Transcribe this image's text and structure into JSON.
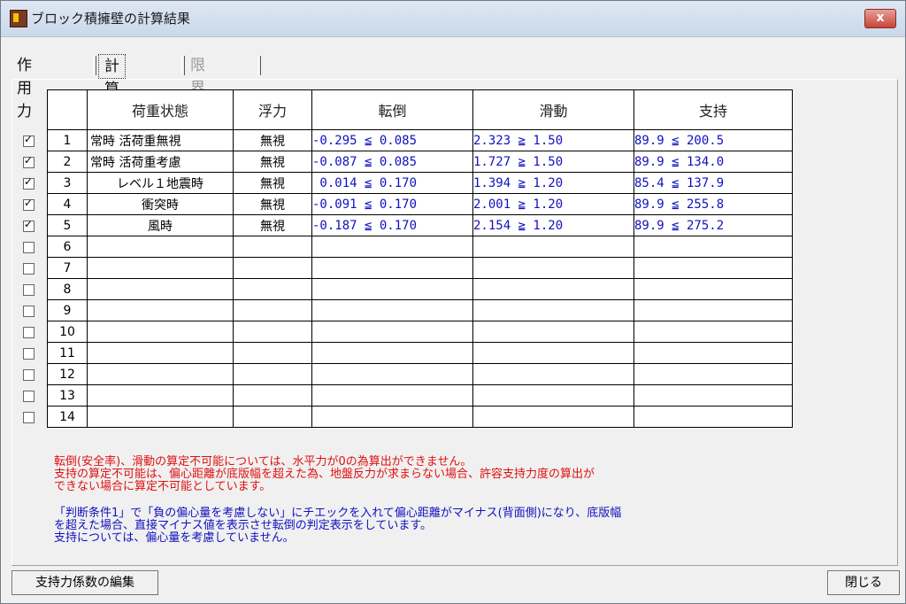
{
  "window": {
    "title": "ブロック積擁壁の計算結果",
    "close_label": "x"
  },
  "tabs": [
    {
      "label": "作用力"
    },
    {
      "label": "計算結果"
    },
    {
      "label": "限界高"
    }
  ],
  "table": {
    "headers": {
      "no": "",
      "load": "荷重状態",
      "buoyancy": "浮力",
      "overturn": "転倒",
      "sliding": "滑動",
      "support": "支持"
    },
    "rows": [
      {
        "checked": true,
        "no": "1",
        "load": "常時 活荷重無視",
        "buoyancy": "無視",
        "overturn": "-0.295 ≦ 0.085",
        "sliding": "2.323 ≧ 1.50",
        "support": "89.9 ≦ 200.5"
      },
      {
        "checked": true,
        "no": "2",
        "load": "常時 活荷重考慮",
        "buoyancy": "無視",
        "overturn": "-0.087 ≦ 0.085",
        "sliding": "1.727 ≧ 1.50",
        "support": "89.9 ≦ 134.0"
      },
      {
        "checked": true,
        "no": "3",
        "load": "レベル１地震時",
        "buoyancy": "無視",
        "overturn": " 0.014 ≦ 0.170",
        "sliding": "1.394 ≧ 1.20",
        "support": "85.4 ≦ 137.9"
      },
      {
        "checked": true,
        "no": "4",
        "load": "衝突時",
        "buoyancy": "無視",
        "overturn": "-0.091 ≦ 0.170",
        "sliding": "2.001 ≧ 1.20",
        "support": "89.9 ≦ 255.8"
      },
      {
        "checked": true,
        "no": "5",
        "load": "風時",
        "buoyancy": "無視",
        "overturn": "-0.187 ≦ 0.170",
        "sliding": "2.154 ≧ 1.20",
        "support": "89.9 ≦ 275.2"
      },
      {
        "checked": false,
        "no": "6",
        "load": "",
        "buoyancy": "",
        "overturn": "",
        "sliding": "",
        "support": ""
      },
      {
        "checked": false,
        "no": "7",
        "load": "",
        "buoyancy": "",
        "overturn": "",
        "sliding": "",
        "support": ""
      },
      {
        "checked": false,
        "no": "8",
        "load": "",
        "buoyancy": "",
        "overturn": "",
        "sliding": "",
        "support": ""
      },
      {
        "checked": false,
        "no": "9",
        "load": "",
        "buoyancy": "",
        "overturn": "",
        "sliding": "",
        "support": ""
      },
      {
        "checked": false,
        "no": "10",
        "load": "",
        "buoyancy": "",
        "overturn": "",
        "sliding": "",
        "support": ""
      },
      {
        "checked": false,
        "no": "11",
        "load": "",
        "buoyancy": "",
        "overturn": "",
        "sliding": "",
        "support": ""
      },
      {
        "checked": false,
        "no": "12",
        "load": "",
        "buoyancy": "",
        "overturn": "",
        "sliding": "",
        "support": ""
      },
      {
        "checked": false,
        "no": "13",
        "load": "",
        "buoyancy": "",
        "overturn": "",
        "sliding": "",
        "support": ""
      },
      {
        "checked": false,
        "no": "14",
        "load": "",
        "buoyancy": "",
        "overturn": "",
        "sliding": "",
        "support": ""
      }
    ]
  },
  "notes": {
    "red": [
      "転倒(安全率)、滑動の算定不可能については、水平力が0の為算出ができません。",
      "支持の算定不可能は、偏心距離が底版幅を超えた為、地盤反力が求まらない場合、許容支持力度の算出が",
      "できない場合に算定不可能としています。"
    ],
    "blue": [
      "「判断条件1」で「負の偏心量を考慮しない」にチエックを入れて偏心距離がマイナス(背面側)になり、底版幅",
      "を超えた場合、直接マイナス値を表示させ転倒の判定表示をしています。",
      "支持については、偏心量を考慮していません。"
    ]
  },
  "buttons": {
    "edit_coeff": "支持力係数の編集",
    "close": "閉じる"
  },
  "colors": {
    "value_blue": "#1010c0",
    "note_red": "#e01010",
    "note_blue": "#1010c0",
    "close_red": "#c8443a"
  }
}
